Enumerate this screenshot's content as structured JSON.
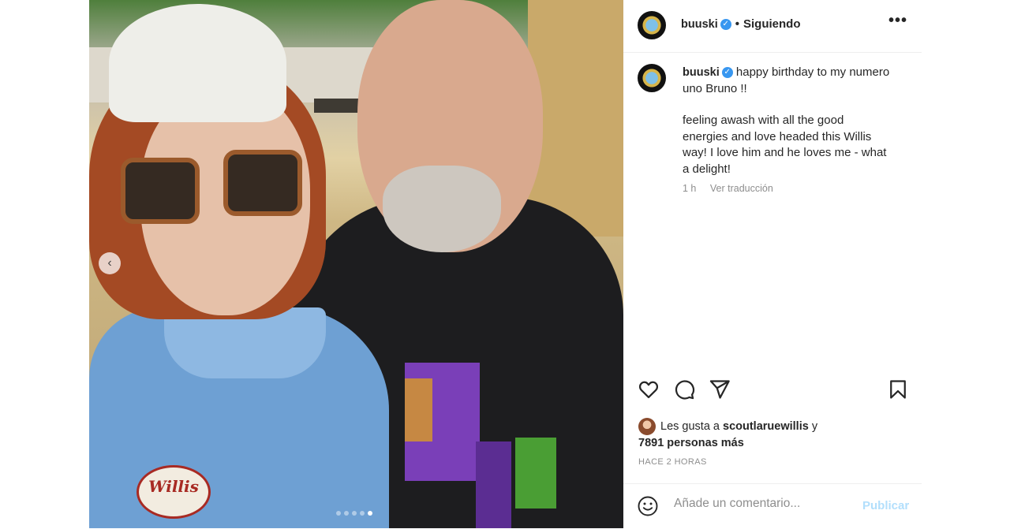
{
  "header": {
    "username": "buuski",
    "separator": "•",
    "follow_status": "Siguiendo",
    "more_icon": "•••"
  },
  "caption": {
    "username": "buuski",
    "line1": "happy birthday to my numero uno Bruno !!",
    "line2": "feeling awash with all the good energies and love headed this Willis way! I love him and he loves me - what a delight!",
    "time": "1 h",
    "translate": "Ver traducción"
  },
  "photo": {
    "patch_text": "Willis",
    "nav_prev_icon": "‹",
    "carousel_dots": 5,
    "active_dot": 5
  },
  "actions": {
    "like_icon": "heart-icon",
    "comment_icon": "comment-icon",
    "share_icon": "send-icon",
    "save_icon": "bookmark-icon"
  },
  "likes": {
    "prefix": "Les gusta a",
    "user": "scoutlaruewillis",
    "joiner": "y",
    "others": "7891 personas más"
  },
  "timestamp": "HACE 2 HORAS",
  "comment": {
    "placeholder": "Añade un comentario...",
    "publish": "Publicar"
  },
  "colors": {
    "verified": "#3897f0",
    "publish_disabled": "#b2dffc",
    "muted_text": "#8e8e8e",
    "divider": "#efefef"
  }
}
